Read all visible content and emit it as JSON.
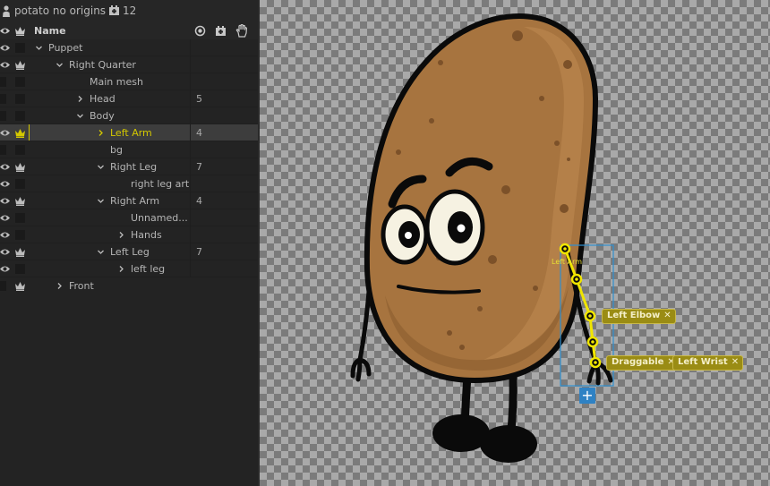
{
  "panel": {
    "puppet_name": "potato no origins",
    "puppet_count": "12",
    "header": {
      "name_label": "Name"
    },
    "rows": [
      {
        "label": "Puppet"
      },
      {
        "label": "Right Quarter"
      },
      {
        "label": "Main mesh"
      },
      {
        "label": "Head",
        "count": "5"
      },
      {
        "label": "Body"
      },
      {
        "label": "Left Arm",
        "count": "4"
      },
      {
        "label": "bg"
      },
      {
        "label": "Right Leg",
        "count": "7"
      },
      {
        "label": "right leg art"
      },
      {
        "label": "Right Arm",
        "count": "4"
      },
      {
        "label": "Unnamed..."
      },
      {
        "label": "Hands"
      },
      {
        "label": "Left Leg",
        "count": "7"
      },
      {
        "label": "left leg"
      },
      {
        "label": "Front"
      }
    ]
  },
  "canvas": {
    "handle_label": "Left Arm",
    "tags": {
      "left_elbow": "Left Elbow",
      "draggable": "Draggable",
      "left_wrist": "Left Wrist",
      "remove_glyph": "✕"
    },
    "add_button": "+"
  },
  "colors": {
    "selection": "#d4c800",
    "potato_body": "#a7743f",
    "tag_background": "#9a8c14",
    "add_button": "#2f82c4"
  }
}
